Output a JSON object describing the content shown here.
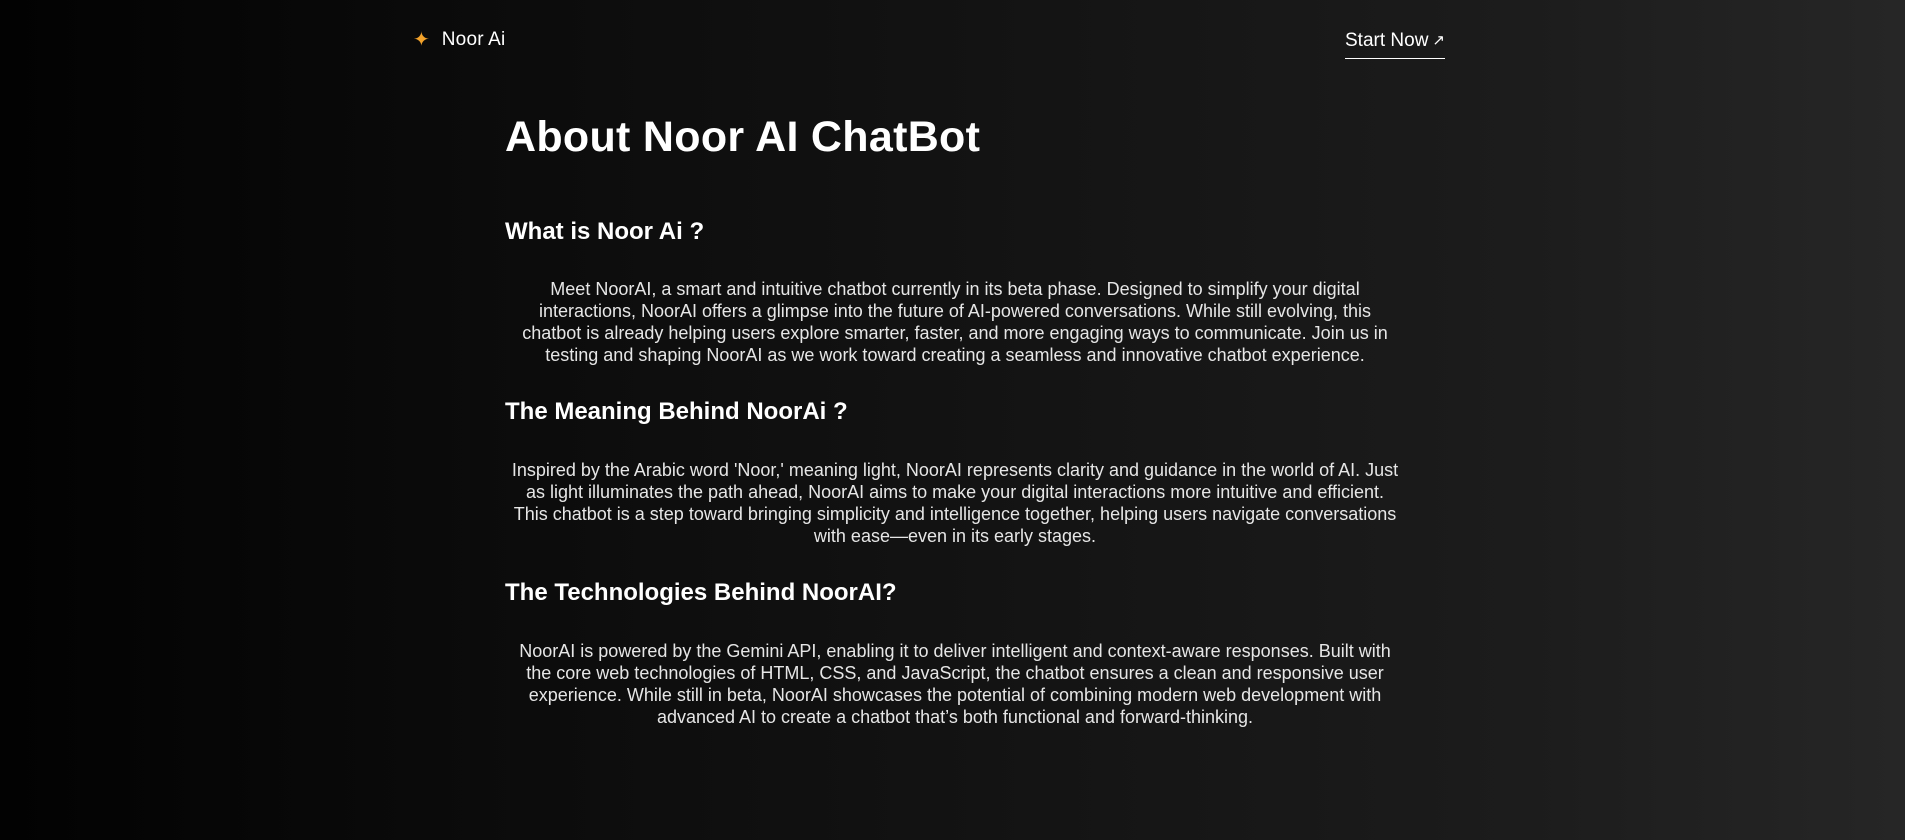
{
  "nav": {
    "brand_icon": "sparkle-icon",
    "brand_icon_glyph": "✦",
    "brand_name": "Noor Ai",
    "cta_label": "Start Now",
    "cta_icon": "arrow-up-right-icon",
    "cta_icon_glyph": "↗"
  },
  "main": {
    "title": "About Noor AI ChatBot",
    "sections": [
      {
        "heading": "What is Noor Ai ?",
        "text": "Meet NoorAI, a smart and intuitive chatbot currently in its beta phase. Designed to simplify your digital interactions, NoorAI offers a glimpse into the future of AI-powered conversations. While still evolving, this chatbot is already helping users explore smarter, faster, and more engaging ways to communicate. Join us in testing and shaping NoorAI as we work toward creating a seamless and innovative chatbot experience."
      },
      {
        "heading": "The Meaning Behind NoorAi ?",
        "text": "Inspired by the Arabic word 'Noor,' meaning light, NoorAI represents clarity and guidance in the world of AI. Just as light illuminates the path ahead, NoorAI aims to make your digital interactions more intuitive and efficient. This chatbot is a step toward bringing simplicity and intelligence together, helping users navigate conversations with ease—even in its early stages."
      },
      {
        "heading": "The Technologies Behind NoorAI?",
        "text": "NoorAI is powered by the Gemini API, enabling it to deliver intelligent and context-aware responses. Built with the core web technologies of HTML, CSS, and JavaScript, the chatbot ensures a clean and responsive user experience. While still in beta, NoorAI showcases the potential of combining modern web development with advanced AI to create a chatbot that’s both functional and forward-thinking."
      }
    ]
  },
  "colors": {
    "accent": "#f2a22b",
    "text": "#ffffff",
    "body_text": "#e6e6e6",
    "background_dark": "#020202",
    "background_light": "#262626"
  }
}
